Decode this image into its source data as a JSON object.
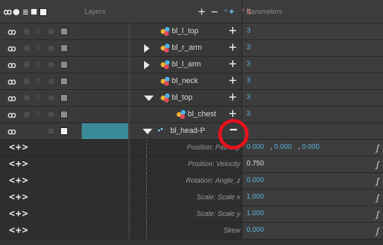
{
  "header": {
    "layers_title": "Layers",
    "parameters_title": "Parameters"
  },
  "toolbar_icons": [
    "add-layer-icon",
    "delete-layer-icon",
    "add-peg-icon",
    "add-drawing-icon"
  ],
  "rows": [
    {
      "name": "bl_l_top",
      "value": "3"
    },
    {
      "name": "bl_r_arm",
      "value": "3"
    },
    {
      "name": "bl_l_arm",
      "value": "3"
    },
    {
      "name": "bl_neck",
      "value": "3"
    },
    {
      "name": "bl_top",
      "value": "3"
    },
    {
      "name": "bl_chest",
      "value": "3"
    },
    {
      "name": "bl_head-P",
      "value": ""
    }
  ],
  "keyframe_icon_text": "<+>",
  "params": [
    {
      "label": "Position: Path,x,y",
      "v1": "0.000",
      "v2": "0.000",
      "v3": "0.000"
    },
    {
      "label": "Position: Velocity",
      "value": "0.750"
    },
    {
      "label": "Rotation: Angle_z",
      "value": "0.000"
    },
    {
      "label": "Scale: Scale x",
      "value": "1.000"
    },
    {
      "label": "Scale: Scale y",
      "value": "1.000"
    },
    {
      "label": "Skew",
      "value": "0.000"
    }
  ],
  "colors": {
    "selection": "#3a8a9a",
    "value_blue": "#5ab2de",
    "highlight_ring": "#e8121c"
  }
}
